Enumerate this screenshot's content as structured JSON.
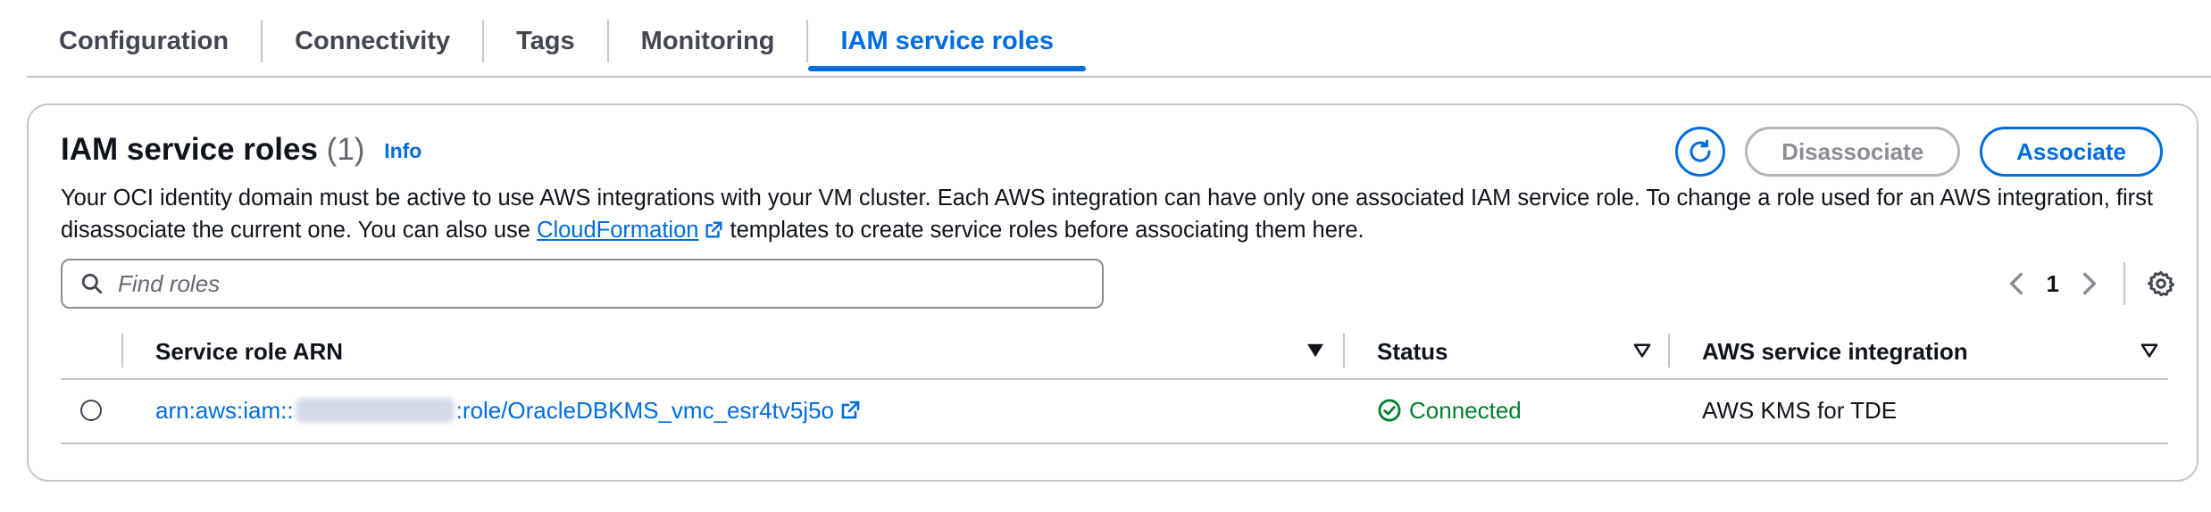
{
  "tabs": [
    {
      "label": "Configuration"
    },
    {
      "label": "Connectivity"
    },
    {
      "label": "Tags"
    },
    {
      "label": "Monitoring"
    },
    {
      "label": "IAM service roles",
      "active": true
    }
  ],
  "panel": {
    "title": "IAM service roles",
    "count": "(1)",
    "info_label": "Info",
    "description_before": "Your OCI identity domain must be active to use AWS integrations with your VM cluster. Each AWS integration can have only one associated IAM service role. To change a role used for an AWS integration, first disassociate the current one. You can also use ",
    "description_link": "CloudFormation",
    "description_after": " templates to create service roles before associating them here.",
    "disassociate_label": "Disassociate",
    "associate_label": "Associate"
  },
  "search": {
    "placeholder": "Find roles",
    "value": ""
  },
  "pagination": {
    "current_page": "1"
  },
  "table": {
    "columns": [
      "Service role ARN",
      "Status",
      "AWS service integration"
    ],
    "rows": [
      {
        "arn_prefix": "arn:aws:iam::",
        "arn_suffix": ":role/OracleDBKMS_vmc_esr4tv5j5o",
        "status": "Connected",
        "integration": "AWS KMS for TDE"
      }
    ]
  },
  "colors": {
    "accent": "#006ce0",
    "success": "#00802f",
    "border": "#c6c6cd"
  },
  "icons": [
    "refresh-icon",
    "search-icon",
    "chevron-left-icon",
    "chevron-right-icon",
    "settings-gear-icon",
    "external-link-icon",
    "sort-down-icon",
    "check-circle-icon"
  ]
}
